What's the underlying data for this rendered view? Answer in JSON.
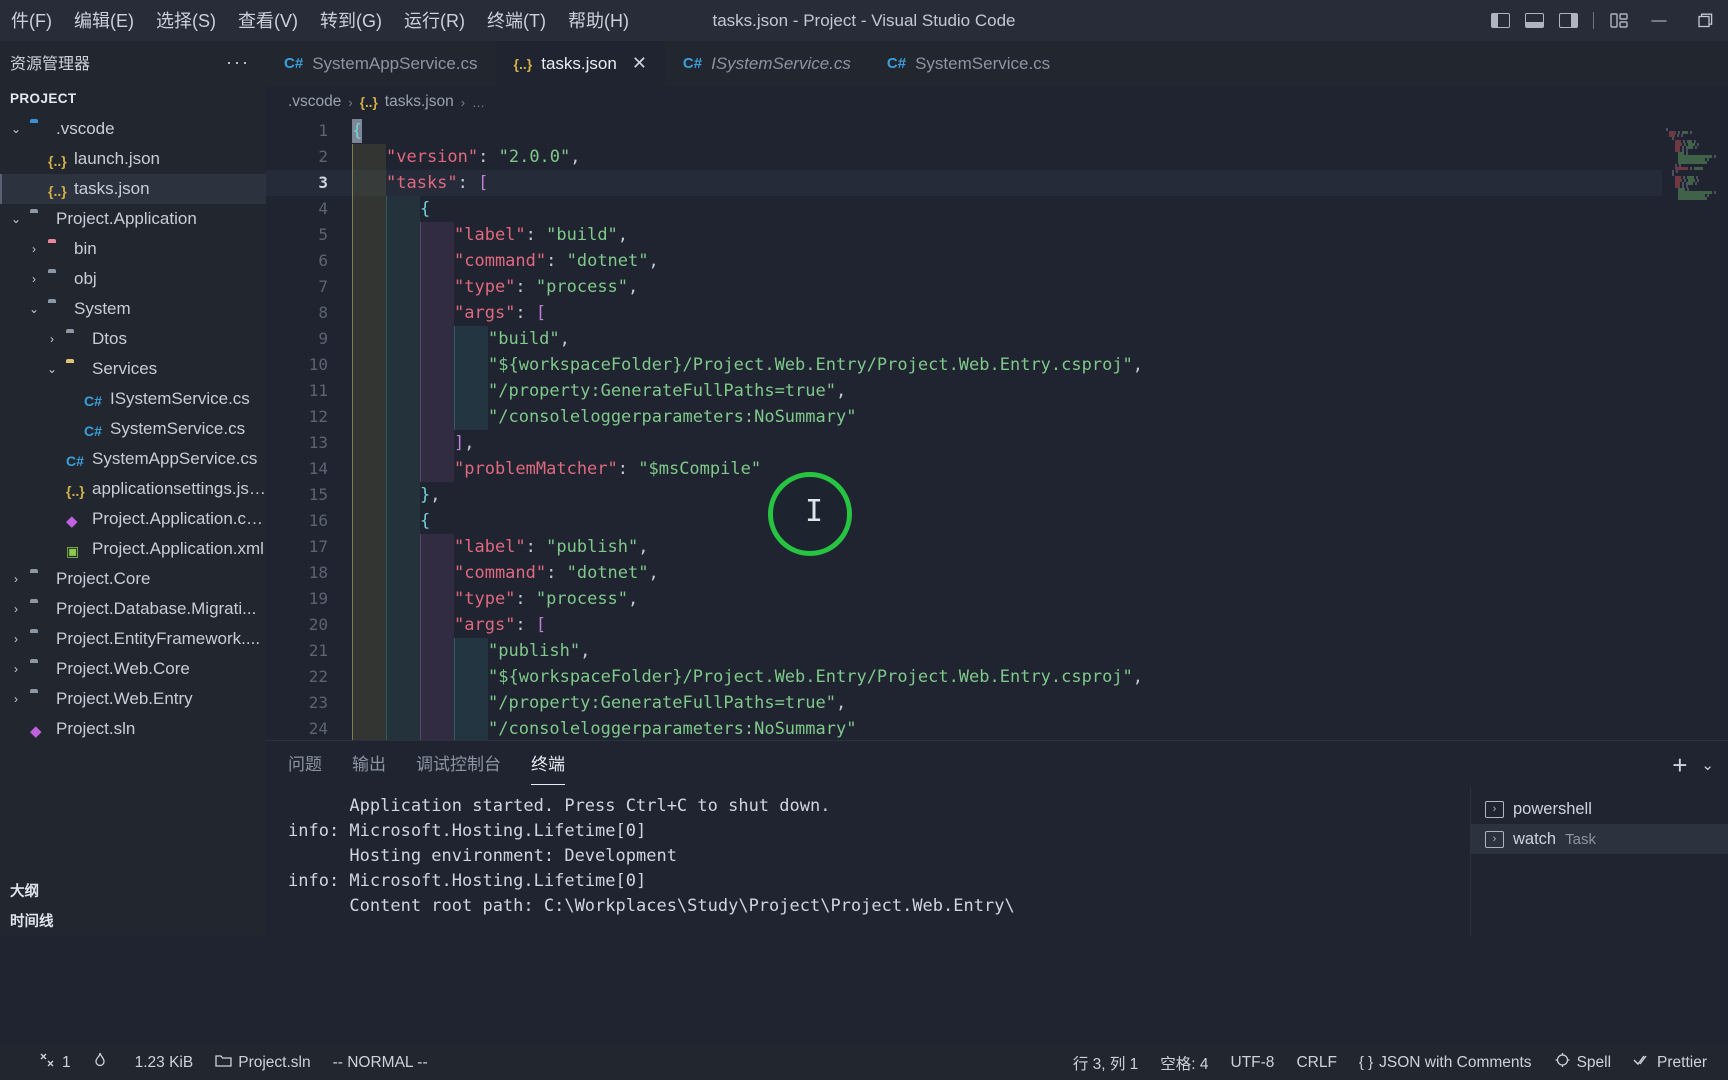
{
  "titlebar": {
    "menus": [
      "件(F)",
      "编辑(E)",
      "选择(S)",
      "查看(V)",
      "转到(G)",
      "运行(R)",
      "终端(T)",
      "帮助(H)"
    ],
    "window_title": "tasks.json - Project - Visual Studio Code",
    "layout_buttons": [
      "toggle-primary-sidebar",
      "toggle-panel",
      "toggle-secondary-sidebar",
      "customize-layout"
    ],
    "window_controls": [
      "minimize",
      "maximize"
    ]
  },
  "sidebar": {
    "header": "资源管理器",
    "more": "···",
    "section_title": "PROJECT",
    "tree": [
      {
        "label": ".vscode",
        "indent": 0,
        "chev": "down",
        "icon": "folder-vs",
        "selected": false
      },
      {
        "label": "launch.json",
        "indent": 1,
        "chev": "none",
        "icon": "json",
        "selected": false
      },
      {
        "label": "tasks.json",
        "indent": 1,
        "chev": "none",
        "icon": "json",
        "selected": true
      },
      {
        "label": "Project.Application",
        "indent": 0,
        "chev": "down",
        "icon": "folder",
        "selected": false
      },
      {
        "label": "bin",
        "indent": 1,
        "chev": "right",
        "icon": "folder-pink",
        "selected": false
      },
      {
        "label": "obj",
        "indent": 1,
        "chev": "right",
        "icon": "folder",
        "selected": false
      },
      {
        "label": "System",
        "indent": 1,
        "chev": "down",
        "icon": "folder",
        "selected": false
      },
      {
        "label": "Dtos",
        "indent": 2,
        "chev": "right",
        "icon": "folder",
        "selected": false
      },
      {
        "label": "Services",
        "indent": 2,
        "chev": "down",
        "icon": "folder-yellow",
        "selected": false
      },
      {
        "label": "ISystemService.cs",
        "indent": 3,
        "chev": "none",
        "icon": "cs",
        "selected": false
      },
      {
        "label": "SystemService.cs",
        "indent": 3,
        "chev": "none",
        "icon": "cs",
        "selected": false
      },
      {
        "label": "SystemAppService.cs",
        "indent": 2,
        "chev": "none",
        "icon": "cs",
        "selected": false
      },
      {
        "label": "applicationsettings.json",
        "indent": 2,
        "chev": "none",
        "icon": "json",
        "selected": false
      },
      {
        "label": "Project.Application.csproj",
        "indent": 2,
        "chev": "none",
        "icon": "sln",
        "selected": false
      },
      {
        "label": "Project.Application.xml",
        "indent": 2,
        "chev": "none",
        "icon": "xml",
        "selected": false
      },
      {
        "label": "Project.Core",
        "indent": 0,
        "chev": "right",
        "icon": "folder",
        "selected": false
      },
      {
        "label": "Project.Database.Migrati...",
        "indent": 0,
        "chev": "right",
        "icon": "folder",
        "selected": false
      },
      {
        "label": "Project.EntityFramework....",
        "indent": 0,
        "chev": "right",
        "icon": "folder",
        "selected": false
      },
      {
        "label": "Project.Web.Core",
        "indent": 0,
        "chev": "right",
        "icon": "folder",
        "selected": false
      },
      {
        "label": "Project.Web.Entry",
        "indent": 0,
        "chev": "right",
        "icon": "folder",
        "selected": false
      },
      {
        "label": "Project.sln",
        "indent": 0,
        "chev": "none",
        "icon": "sln",
        "selected": false
      }
    ],
    "outline": "大纲",
    "timeline": "时间线"
  },
  "tabs": [
    {
      "label": "SystemAppService.cs",
      "icon": "cs",
      "active": false,
      "italic": false,
      "close": false
    },
    {
      "label": "tasks.json",
      "icon": "json",
      "active": true,
      "italic": false,
      "close": true
    },
    {
      "label": "ISystemService.cs",
      "icon": "cs",
      "active": false,
      "italic": true,
      "close": false
    },
    {
      "label": "SystemService.cs",
      "icon": "cs",
      "active": false,
      "italic": false,
      "close": false
    }
  ],
  "breadcrumb": {
    "folder": ".vscode",
    "file": "tasks.json",
    "more": "…",
    "sep": "›"
  },
  "editor": {
    "current_line": 3,
    "lines": [
      {
        "n": 1,
        "indent": 0,
        "cursor_block": true,
        "tokens": [
          {
            "t": "{",
            "c": "br"
          }
        ]
      },
      {
        "n": 2,
        "indent": 1,
        "tokens": [
          {
            "t": "\"version\"",
            "c": "k"
          },
          {
            "t": ": ",
            "c": "p"
          },
          {
            "t": "\"2.0.0\"",
            "c": "s"
          },
          {
            "t": ",",
            "c": "p"
          }
        ]
      },
      {
        "n": 3,
        "indent": 1,
        "current": true,
        "tokens": [
          {
            "t": "\"tasks\"",
            "c": "k"
          },
          {
            "t": ": ",
            "c": "p"
          },
          {
            "t": "[",
            "c": "brp"
          }
        ]
      },
      {
        "n": 4,
        "indent": 2,
        "tokens": [
          {
            "t": "{",
            "c": "br"
          }
        ]
      },
      {
        "n": 5,
        "indent": 3,
        "tokens": [
          {
            "t": "\"label\"",
            "c": "k"
          },
          {
            "t": ": ",
            "c": "p"
          },
          {
            "t": "\"build\"",
            "c": "s"
          },
          {
            "t": ",",
            "c": "p"
          }
        ]
      },
      {
        "n": 6,
        "indent": 3,
        "tokens": [
          {
            "t": "\"command\"",
            "c": "k"
          },
          {
            "t": ": ",
            "c": "p"
          },
          {
            "t": "\"dotnet\"",
            "c": "s"
          },
          {
            "t": ",",
            "c": "p"
          }
        ]
      },
      {
        "n": 7,
        "indent": 3,
        "tokens": [
          {
            "t": "\"type\"",
            "c": "k"
          },
          {
            "t": ": ",
            "c": "p"
          },
          {
            "t": "\"process\"",
            "c": "s"
          },
          {
            "t": ",",
            "c": "p"
          }
        ]
      },
      {
        "n": 8,
        "indent": 3,
        "tokens": [
          {
            "t": "\"args\"",
            "c": "k"
          },
          {
            "t": ": ",
            "c": "p"
          },
          {
            "t": "[",
            "c": "brp"
          }
        ]
      },
      {
        "n": 9,
        "indent": 4,
        "tokens": [
          {
            "t": "\"build\"",
            "c": "s"
          },
          {
            "t": ",",
            "c": "p"
          }
        ]
      },
      {
        "n": 10,
        "indent": 4,
        "tokens": [
          {
            "t": "\"${workspaceFolder}/Project.Web.Entry/Project.Web.Entry.csproj\"",
            "c": "s"
          },
          {
            "t": ",",
            "c": "p"
          }
        ]
      },
      {
        "n": 11,
        "indent": 4,
        "tokens": [
          {
            "t": "\"/property:GenerateFullPaths=true\"",
            "c": "s"
          },
          {
            "t": ",",
            "c": "p"
          }
        ]
      },
      {
        "n": 12,
        "indent": 4,
        "tokens": [
          {
            "t": "\"/consoleloggerparameters:NoSummary\"",
            "c": "s"
          }
        ]
      },
      {
        "n": 13,
        "indent": 3,
        "tokens": [
          {
            "t": "]",
            "c": "brp"
          },
          {
            "t": ",",
            "c": "p"
          }
        ]
      },
      {
        "n": 14,
        "indent": 3,
        "tokens": [
          {
            "t": "\"problemMatcher\"",
            "c": "k"
          },
          {
            "t": ": ",
            "c": "p"
          },
          {
            "t": "\"$msCompile\"",
            "c": "s"
          }
        ]
      },
      {
        "n": 15,
        "indent": 2,
        "tokens": [
          {
            "t": "}",
            "c": "br"
          },
          {
            "t": ",",
            "c": "p"
          }
        ]
      },
      {
        "n": 16,
        "indent": 2,
        "tokens": [
          {
            "t": "{",
            "c": "br"
          }
        ]
      },
      {
        "n": 17,
        "indent": 3,
        "tokens": [
          {
            "t": "\"label\"",
            "c": "k"
          },
          {
            "t": ": ",
            "c": "p"
          },
          {
            "t": "\"publish\"",
            "c": "s"
          },
          {
            "t": ",",
            "c": "p"
          }
        ]
      },
      {
        "n": 18,
        "indent": 3,
        "tokens": [
          {
            "t": "\"command\"",
            "c": "k"
          },
          {
            "t": ": ",
            "c": "p"
          },
          {
            "t": "\"dotnet\"",
            "c": "s"
          },
          {
            "t": ",",
            "c": "p"
          }
        ]
      },
      {
        "n": 19,
        "indent": 3,
        "tokens": [
          {
            "t": "\"type\"",
            "c": "k"
          },
          {
            "t": ": ",
            "c": "p"
          },
          {
            "t": "\"process\"",
            "c": "s"
          },
          {
            "t": ",",
            "c": "p"
          }
        ]
      },
      {
        "n": 20,
        "indent": 3,
        "tokens": [
          {
            "t": "\"args\"",
            "c": "k"
          },
          {
            "t": ": ",
            "c": "p"
          },
          {
            "t": "[",
            "c": "brp"
          }
        ]
      },
      {
        "n": 21,
        "indent": 4,
        "tokens": [
          {
            "t": "\"publish\"",
            "c": "s"
          },
          {
            "t": ",",
            "c": "p"
          }
        ]
      },
      {
        "n": 22,
        "indent": 4,
        "tokens": [
          {
            "t": "\"${workspaceFolder}/Project.Web.Entry/Project.Web.Entry.csproj\"",
            "c": "s"
          },
          {
            "t": ",",
            "c": "p"
          }
        ]
      },
      {
        "n": 23,
        "indent": 4,
        "tokens": [
          {
            "t": "\"/property:GenerateFullPaths=true\"",
            "c": "s"
          },
          {
            "t": ",",
            "c": "p"
          }
        ]
      },
      {
        "n": 24,
        "indent": 4,
        "tokens": [
          {
            "t": "\"/consoleloggerparameters:NoSummary\"",
            "c": "s"
          }
        ]
      }
    ]
  },
  "panel": {
    "tabs": [
      {
        "label": "问题",
        "active": false
      },
      {
        "label": "输出",
        "active": false
      },
      {
        "label": "调试控制台",
        "active": false
      },
      {
        "label": "终端",
        "active": true
      }
    ],
    "actions": {
      "new": "+",
      "chevron": "⌄"
    },
    "terminal_output": "      Application started. Press Ctrl+C to shut down.\ninfo: Microsoft.Hosting.Lifetime[0]\n      Hosting environment: Development\ninfo: Microsoft.Hosting.Lifetime[0]\n      Content root path: C:\\Workplaces\\Study\\Project\\Project.Web.Entry\\",
    "terminal_list": [
      {
        "name": "powershell",
        "sub": "",
        "selected": false
      },
      {
        "name": "watch",
        "sub": "Task",
        "selected": true
      }
    ]
  },
  "statusbar": {
    "left": [
      {
        "name": "remote-indicator",
        "text": ""
      },
      {
        "name": "problems",
        "text": "1",
        "icon": "tools-icon"
      },
      {
        "name": "flame",
        "text": "",
        "icon": "flame-icon"
      },
      {
        "name": "filesize",
        "text": "1.23 KiB"
      },
      {
        "name": "solution",
        "text": "Project.sln",
        "icon": "folder-icon"
      },
      {
        "name": "vim-mode",
        "text": "-- NORMAL --"
      }
    ],
    "right": [
      {
        "name": "cursor-position",
        "text": "行 3, 列 1"
      },
      {
        "name": "indentation",
        "text": "空格: 4"
      },
      {
        "name": "encoding",
        "text": "UTF-8"
      },
      {
        "name": "eol",
        "text": "CRLF"
      },
      {
        "name": "language-mode",
        "text": "JSON with Comments",
        "icon": "braces-icon"
      },
      {
        "name": "spell-checker",
        "text": "Spell",
        "icon": "spell-icon"
      },
      {
        "name": "prettier",
        "text": "Prettier",
        "icon": "check-icon"
      }
    ]
  },
  "colors": {
    "accent_green": "#26c440",
    "string": "#7fc98a",
    "key": "#e0697e",
    "bg": "#1f2430",
    "chrome": "#21262f",
    "titlebar": "#272c38"
  }
}
